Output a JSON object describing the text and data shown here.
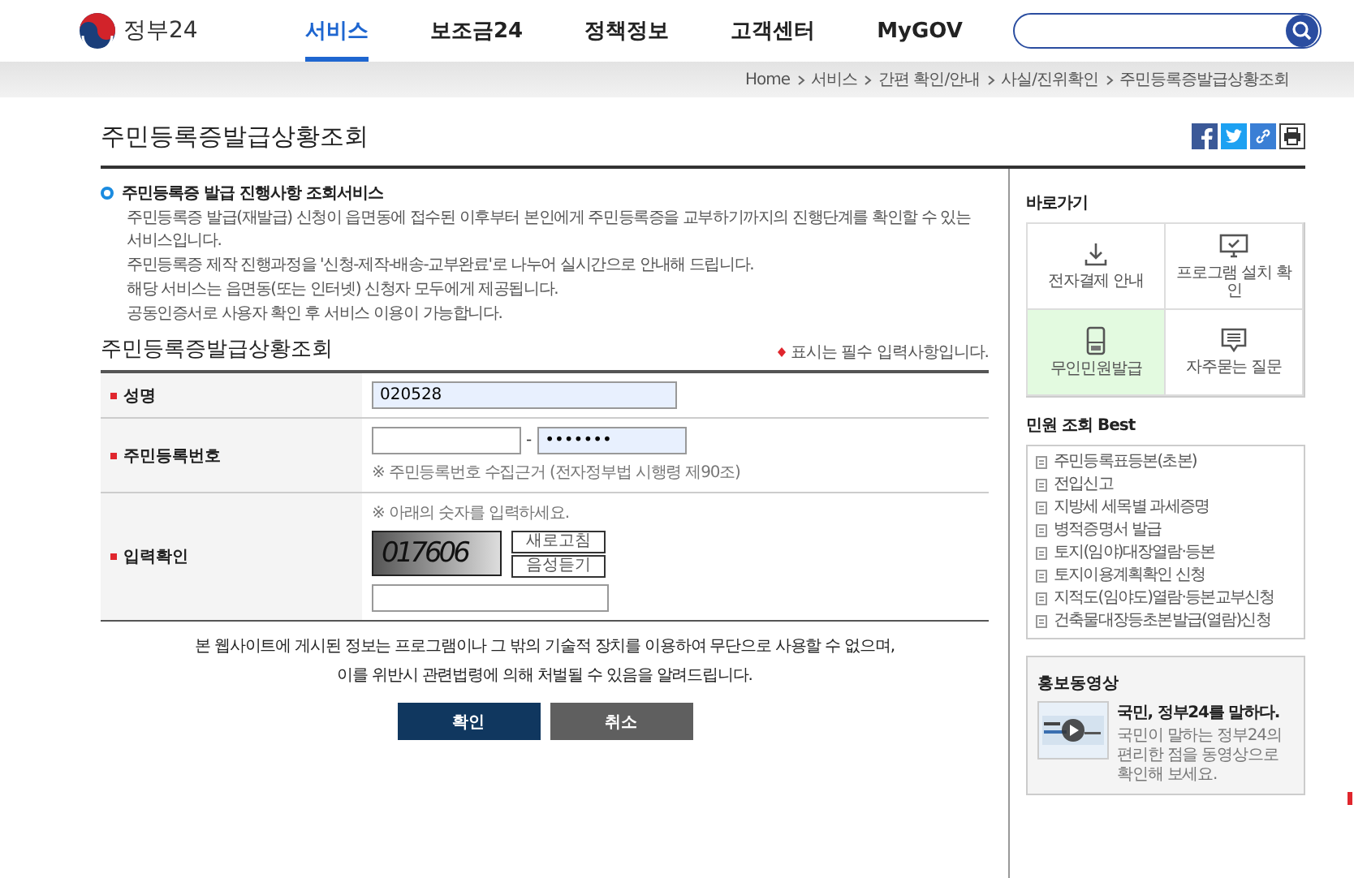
{
  "header": {
    "logo": "정부24",
    "nav": [
      {
        "label": "서비스",
        "selected": true
      },
      {
        "label": "보조금24",
        "selected": false
      },
      {
        "label": "정책정보",
        "selected": false
      },
      {
        "label": "고객센터",
        "selected": false
      },
      {
        "label": "MyGOV",
        "selected": false
      }
    ]
  },
  "breadcrumb": [
    "Home",
    "서비스",
    "간편 확인/안내",
    "사실/진위확인",
    "주민등록증발급상황조회"
  ],
  "page_title": "주민등록증발급상황조회",
  "intro": {
    "heading": "주민등록증 발급 진행사항 조회서비스",
    "items": [
      "주민등록증 발급(재발급) 신청이 읍면동에 접수된 이후부터 본인에게 주민등록증을 교부하기까지의 진행단계를 확인할 수 있는 서비스입니다.",
      "주민등록증 제작 진행과정을 '신청-제작-배송-교부완료'로 나누어 실시간으로 안내해 드립니다.",
      "해당 서비스는 읍면동(또는 인터넷) 신청자 모두에게 제공됩니다.",
      "공동인증서로 사용자 확인 후 서비스 이용이 가능합니다."
    ]
  },
  "form": {
    "title": "주민등록증발급상황조회",
    "required_note": "표시는 필수 입력사항입니다.",
    "rows": [
      {
        "kind": "name",
        "label": "성명",
        "required": true,
        "value": "020528"
      },
      {
        "kind": "rrn",
        "label": "주민등록번호",
        "required": true,
        "value_2": "•••••••",
        "separator": "-",
        "note": "※ 주민등록번호 수집근거 (전자정부법 시행령 제90조)"
      },
      {
        "kind": "captcha",
        "label": "입력확인",
        "required": true,
        "note": "※ 아래의 숫자를 입력하세요.",
        "captcha_text": "017606",
        "buttons": [
          "새로고침",
          "음성듣기"
        ]
      }
    ]
  },
  "notice": [
    "본 웹사이트에 게시된 정보는 프로그램이나 그 밖의 기술적 장치를 이용하여 무단으로 사용할 수 없으며,",
    "이를 위반시 관련법령에 의해 처벌될 수 있음을 알려드립니다."
  ],
  "buttons": [
    {
      "label": "확인",
      "kind": "primary"
    },
    {
      "label": "취소",
      "kind": "secondary"
    }
  ],
  "sidebar": {
    "quick_title": "바로가기",
    "quick_links": [
      {
        "label": "전자결제 안내",
        "selected": false
      },
      {
        "label": "프로그램 설치 확인",
        "selected": false
      },
      {
        "label": "무인민원발급",
        "selected": true
      },
      {
        "label": "자주묻는 질문",
        "selected": false
      }
    ],
    "best_title": "민원 조회 Best",
    "best": [
      "주민등록표등본(초본)",
      "전입신고",
      "지방세 세목별 과세증명",
      "병적증명서 발급",
      "토지(임야)대장열람·등본",
      "토지이용계획확인 신청",
      "지적도(임야도)열람·등본교부신청",
      "건축물대장등초본발급(열람)신청"
    ],
    "promo_title": "홍보동영상",
    "promo_headline": "국민, 정부24를 말하다.",
    "promo_text": "국민이 말하는 정부24의 편리한 점을 동영상으로 확인해 보세요."
  }
}
